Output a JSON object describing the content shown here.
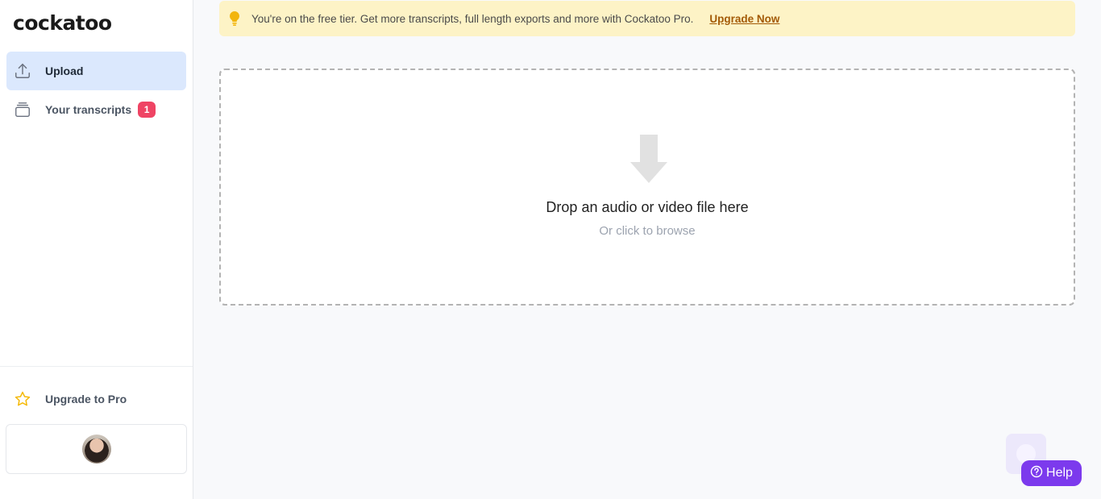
{
  "app": {
    "logo": "cockatoo"
  },
  "sidebar": {
    "items": [
      {
        "label": "Upload",
        "icon": "upload-icon",
        "active": true
      },
      {
        "label": "Your transcripts",
        "icon": "layers-icon",
        "badge": "1"
      }
    ],
    "upgrade": {
      "label": "Upgrade to Pro",
      "icon": "star-icon"
    }
  },
  "banner": {
    "icon": "lightbulb-icon",
    "message": "You're on the free tier. Get more transcripts, full length exports and more with Cockatoo Pro.",
    "link": "Upgrade Now"
  },
  "dropzone": {
    "icon": "down-arrow-icon",
    "title": "Drop an audio or video file here",
    "subtitle": "Or click to browse"
  },
  "help": {
    "label": "Help",
    "icon": "question-circle-icon"
  },
  "colors": {
    "accent": "#7c3aed",
    "active_nav_bg": "#dbe8fd",
    "badge": "#ef4464",
    "banner_bg": "#fdf3c6",
    "banner_link": "#a35a06",
    "star": "#f5b800"
  }
}
